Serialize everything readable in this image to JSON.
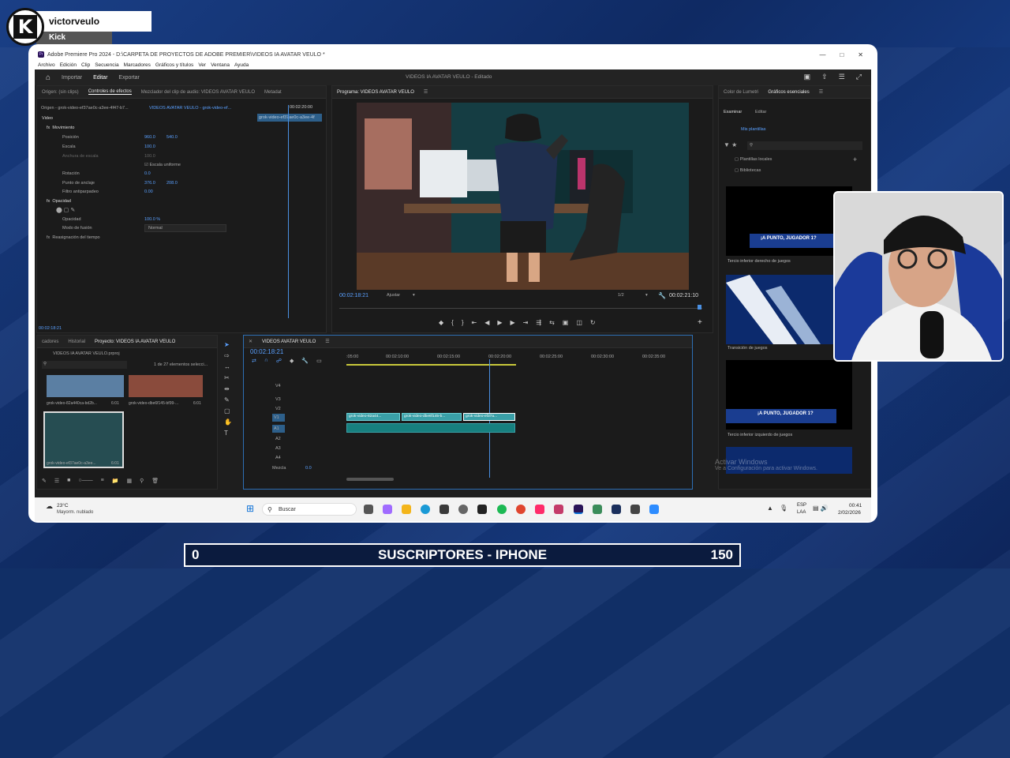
{
  "overlay": {
    "streamer": "victorveulo",
    "platform": "Kick",
    "logo_letter": "K",
    "bottom_bar": {
      "left": "0",
      "center": "SUSCRIPTORES - IPHONE",
      "right": "150"
    }
  },
  "window": {
    "title": "Adobe Premiere Pro 2024 - D:\\CARPETA DE PROYECTOS DE ADOBE PREMIER\\VIDEOS IA AVATAR VEULO *",
    "app_badge": "Pr",
    "menu": [
      "Archivo",
      "Edición",
      "Clip",
      "Secuencia",
      "Marcadores",
      "Gráficos y títulos",
      "Ver",
      "Ventana",
      "Ayuda"
    ],
    "workspace_tabs": [
      "Importar",
      "Editar",
      "Exportar"
    ],
    "active_workspace": "Editar",
    "project_status": "VIDEOS IA AVATAR VEULO - Editado"
  },
  "effects_panel": {
    "tabs": [
      "Origen: (sin clips)",
      "Controles de efectos",
      "Mezclador del clip de audio: VIDEOS AVATAR VEULO",
      "Metadat"
    ],
    "source_label": "Origen - grok-video-ef37ae0c-a3ee-4f47-b7...",
    "sequence_label": "VIDEOS AVATAR VEULO - grok-video-ef...",
    "timecode_top": "00:02:20:00",
    "clip_label": "grok-video-ef37ae0c-a3ee-4f",
    "section_video": "Video",
    "movimiento": "Movimiento",
    "posicion": {
      "label": "Posición",
      "x": "960.0",
      "y": "540.0"
    },
    "escala": {
      "label": "Escala",
      "value": "100.0"
    },
    "anchura": {
      "label": "Anchura de escala",
      "value": "100.0"
    },
    "escala_uniforme": "Escala uniforme",
    "rotacion": {
      "label": "Rotación",
      "value": "0.0"
    },
    "anclaje": {
      "label": "Punto de anclaje",
      "x": "376.0",
      "y": "208.0"
    },
    "antiparpadeo": {
      "label": "Filtro antiparpadeo",
      "value": "0.00"
    },
    "opacidad_section": "Opacidad",
    "opacidad": {
      "label": "Opacidad",
      "value": "100.0 %"
    },
    "modo": {
      "label": "Modo de fusión",
      "value": "Normal"
    },
    "reasignacion": "Reasignación del tiempo",
    "timecode_bottom": "00:02:18:21"
  },
  "program_monitor": {
    "title": "Programa: VIDEOS AVATAR VEULO",
    "timecode": "00:02:18:21",
    "fit": "Ajustar",
    "ratio": "1/2",
    "duration": "00:02:21:10"
  },
  "project_panel": {
    "tabs": [
      "cadores",
      "Historial",
      "Proyecto: VIDEOS IA AVATAR VEULO"
    ],
    "file": "VIDEOS IA AVATAR VEULO.prproj",
    "count": "1 de 27 elementos selecci...",
    "items": [
      {
        "name": "grok-video-82a440ca-bd2b...",
        "dur": "6:01"
      },
      {
        "name": "grok-video-dbe6f145-bf99-...",
        "dur": "6:01"
      },
      {
        "name": "grok-video-ef37ae0c-a3ee...",
        "dur": "6:01"
      }
    ]
  },
  "timeline": {
    "title": "VIDEOS AVATAR VEULO",
    "timecode": "00:02:18:21",
    "ruler": [
      ":05:00",
      "00:02:10:00",
      "00:02:15:00",
      "00:02:20:00",
      "00:02:25:00",
      "00:02:30:00",
      "00:02:35:00"
    ],
    "tracks_video": [
      "V4",
      "V3",
      "V2",
      "V1"
    ],
    "tracks_audio": [
      "A1",
      "A2",
      "A3",
      "A4"
    ],
    "mix_label": "Mezcla",
    "mix_value": "0.0",
    "clips": [
      "grok-video-82a44...",
      "grok-video-dbe6f145-b...",
      "grok-video-ef37a..."
    ],
    "fx": "fx"
  },
  "essential_graphics": {
    "tabs": [
      "Color de Lumetri",
      "Gráficos esenciales"
    ],
    "subtabs": [
      "Examinar",
      "Editar"
    ],
    "templates_btn": "Mis plantillas",
    "tree": [
      "Plantillas locales",
      "Bibliotecas"
    ],
    "items": [
      {
        "label": "Tercio inferior derecho de juegos",
        "banner": "¡A PUNTO, JUGADOR 1?"
      },
      {
        "label": "Transición de juegos",
        "banner": ""
      },
      {
        "label": "Tercio inferior izquierdo de juegos",
        "banner": "¡A PUNTO, JUGADOR 1?"
      }
    ]
  },
  "watermark": {
    "line1": "Activar Windows",
    "line2": "Ve a Configuración para activar Windows."
  },
  "taskbar": {
    "weather_temp": "23°C",
    "weather_desc": "Mayorm. nublado",
    "search": "Buscar",
    "lang": "ESP",
    "lang2": "LAA",
    "time": "00:41",
    "date": "2/02/2026"
  },
  "colors": {
    "accent": "#2d8cff",
    "playhead": "#4a90e2",
    "clip": "#3aa0a8"
  }
}
